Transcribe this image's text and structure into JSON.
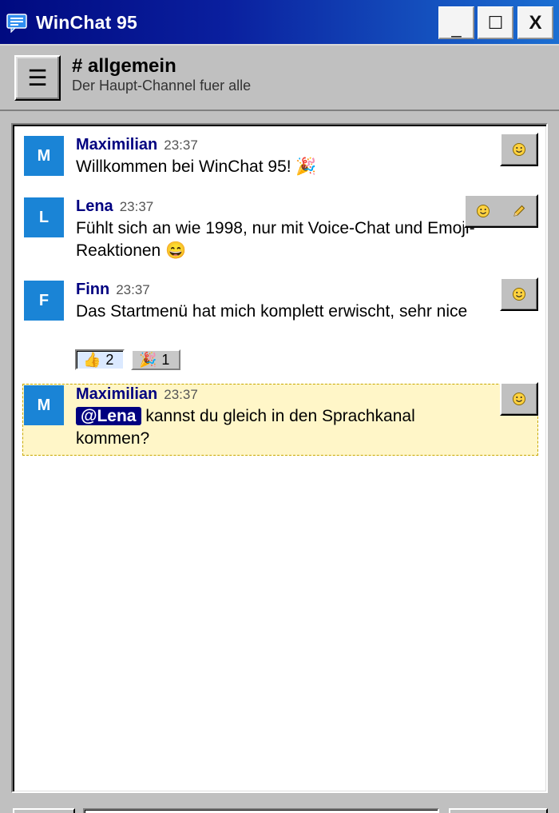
{
  "window": {
    "title": "WinChat 95",
    "minimize_label": "_",
    "maximize_label": "☐",
    "close_label": "X"
  },
  "channel": {
    "menu_icon": "☰",
    "name": "# allgemein",
    "description": "Der Haupt-Channel fuer alle"
  },
  "messages": [
    {
      "author": "Maximilian",
      "initial": "M",
      "time": "23:37",
      "text": "Willkommen bei WinChat 95! 🎉",
      "actions": [
        "emoji-icon"
      ]
    },
    {
      "author": "Lena",
      "initial": "L",
      "time": "23:37",
      "text": "Fühlt sich an wie 1998, nur mit Voice-Chat und Emoji-Reaktionen 😄",
      "actions": [
        "emoji-icon",
        "edit-pencil-icon"
      ]
    },
    {
      "author": "Finn",
      "initial": "F",
      "time": "23:37",
      "text": "Das Startmenü hat mich komplett erwischt, sehr nice",
      "actions": [
        "emoji-icon"
      ],
      "reactions": [
        {
          "emoji": "👍",
          "count": "2",
          "active": true
        },
        {
          "emoji": "🎉",
          "count": "1",
          "active": false
        }
      ]
    },
    {
      "author": "Maximilian",
      "initial": "M",
      "time": "23:37",
      "mention": "@Lena",
      "text": " kannst du gleich in den Sprachkanal kommen?",
      "highlighted": true,
      "actions": [
        "emoji-icon"
      ]
    }
  ],
  "colors": {
    "titlebar_start": "#000a80",
    "titlebar_end": "#1b6fd2",
    "avatar": "#1a84d6",
    "author": "#000080",
    "highlight_bg": "#fff6c8",
    "mention_bg": "#000080"
  }
}
